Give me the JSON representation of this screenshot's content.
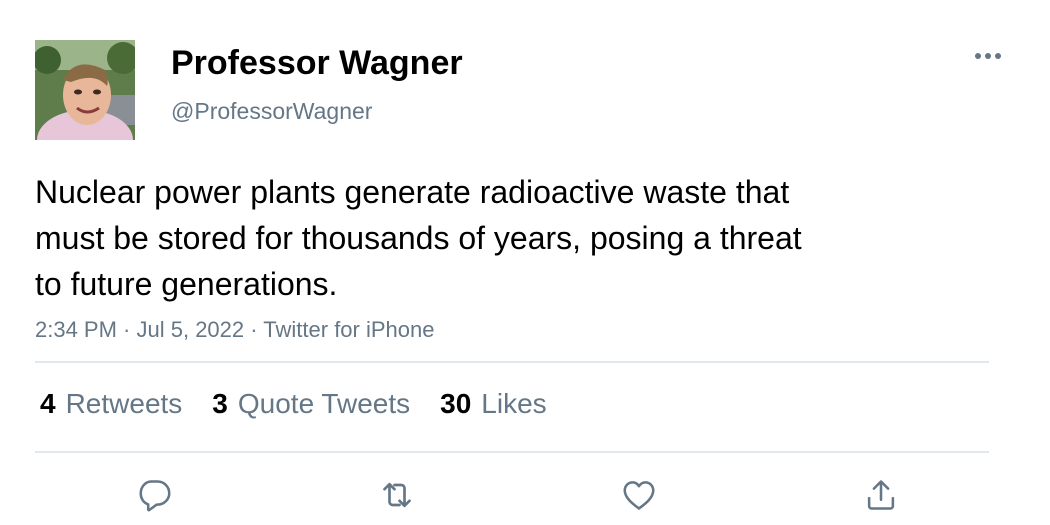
{
  "author": {
    "display_name": "Professor Wagner",
    "handle": "@ProfessorWagner"
  },
  "tweet": {
    "text_lines": [
      "Nuclear power plants generate radioactive waste that",
      "must be stored for thousands of years, posing a threat",
      "to future generations."
    ],
    "time": "2:34 PM",
    "date": "Jul 5, 2022",
    "source": "Twitter for iPhone",
    "separator": " · "
  },
  "stats": {
    "retweets": {
      "count": "4",
      "label": "Retweets"
    },
    "quote_tweets": {
      "count": "3",
      "label": "Quote Tweets"
    },
    "likes": {
      "count": "30",
      "label": "Likes"
    }
  },
  "actions": {
    "reply_icon": "reply-icon",
    "retweet_icon": "retweet-icon",
    "like_icon": "heart-icon",
    "share_icon": "share-icon"
  },
  "colors": {
    "text_primary": "#000000",
    "text_secondary": "#657786",
    "divider": "#e1e8ed"
  }
}
